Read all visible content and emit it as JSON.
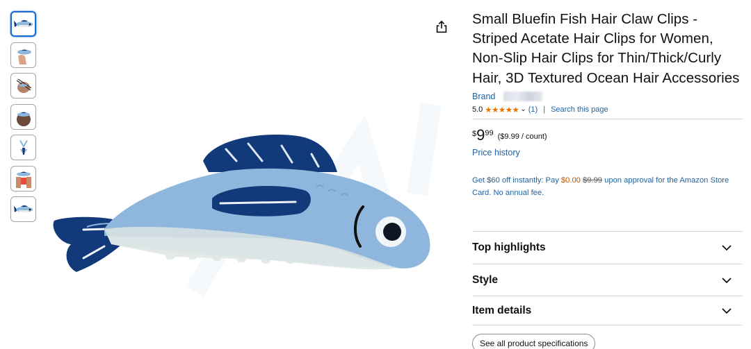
{
  "thumbnails": [
    {
      "icon": "fish-clip-side-thumb",
      "selected": true
    },
    {
      "icon": "fish-clip-hand-thumb"
    },
    {
      "icon": "fish-clip-chopsticks-thumb"
    },
    {
      "icon": "fish-clip-hair-thumb"
    },
    {
      "icon": "fish-clip-top-thumb"
    },
    {
      "icon": "fish-clip-hands-thumb"
    },
    {
      "icon": "fish-clip-side-thumb-2"
    }
  ],
  "product": {
    "title": "Small Bluefin Fish Hair Claw Clips - Striped Acetate Hair Clips for Women, Non-Slip Hair Clips for Thin/Thick/Curly Hair, 3D Textured Ocean Hair Accessories",
    "brand_label": "Brand",
    "rating_value": "5.0",
    "stars": "★★★★★",
    "rating_count": "(1)",
    "search_link": "Search this page",
    "price_symbol": "$",
    "price_whole": "9",
    "price_fraction": "99",
    "unit_price": "($9.99 / count)",
    "price_history": "Price history"
  },
  "promo": {
    "part1": "Get $60 off instantly: Pay ",
    "pay_amount": "$0.00",
    "strike_amount": "$9.99",
    "part2": " upon approval for the Amazon Store Card. No annual fee."
  },
  "accordion": [
    {
      "label": "Top highlights"
    },
    {
      "label": "Style"
    },
    {
      "label": "Item details"
    }
  ],
  "spec_button": "See all product specifications",
  "colors": {
    "link": "#2162a1",
    "star": "#e77600",
    "fish_body": "#8fb6dc",
    "fish_dark": "#123a7a",
    "fish_teeth": "#e7ece8"
  }
}
